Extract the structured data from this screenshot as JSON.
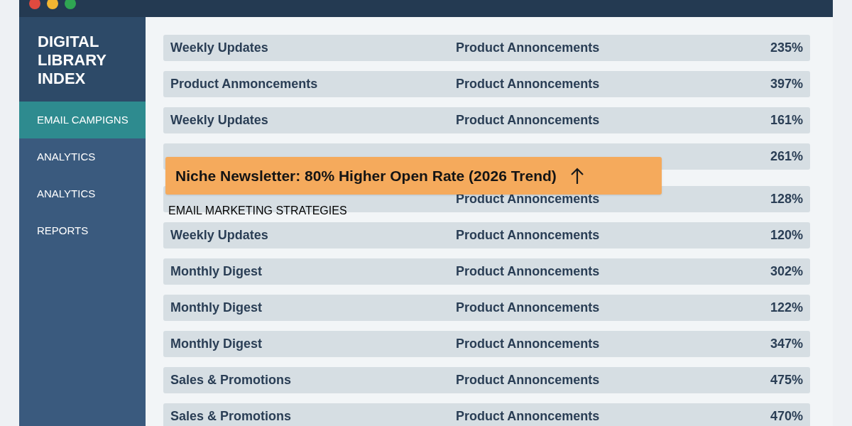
{
  "sidebar": {
    "title": "DIGITAL LIBRARY INDEX",
    "items": [
      {
        "label": "EMAIL CAMPIGNS",
        "selected": true
      },
      {
        "label": "ANALYTICS",
        "selected": false
      },
      {
        "label": "ANALYTICS",
        "selected": false
      },
      {
        "label": "REPORTS",
        "selected": false
      }
    ]
  },
  "table": {
    "rows": [
      {
        "column_1": "Weekly Updates",
        "column_2": "Product Annoncements",
        "column_3": "235%"
      },
      {
        "column_1": "Product Anmoncements",
        "column_2": "Product Annoncements",
        "column_3": "397%"
      },
      {
        "column_1": "Weekly Updates",
        "column_2": "Product Annoncements",
        "column_3": "161%"
      },
      {
        "column_3": "261%"
      },
      {
        "column_2": "Product Annoncements",
        "column_3": "128%"
      },
      {
        "column_1": "Weekly Updates",
        "column_2": "Product Annoncements",
        "column_3": "120%"
      },
      {
        "column_1": "Monthly Digest",
        "column_2": "Product Annoncements",
        "column_3": "302%"
      },
      {
        "column_1": "Monthly Digest",
        "column_2": "Product Annoncements",
        "column_3": "122%"
      },
      {
        "column_1": "Monthly Digest",
        "column_2": "Product Annoncements",
        "column_3": "347%"
      },
      {
        "column_1": "Sales & Promotions",
        "column_2": "Product Annoncements",
        "column_3": "475%"
      },
      {
        "column_1": "Sales & Promotions",
        "column_2": "Product Annoncements",
        "column_3": "470%"
      }
    ]
  },
  "banner": {
    "text": "Niche Newsletter: 80% Higher Open Rate (2026 Trend)"
  },
  "overlay_label": "EMAIL MARKETING STRATEGIES"
}
